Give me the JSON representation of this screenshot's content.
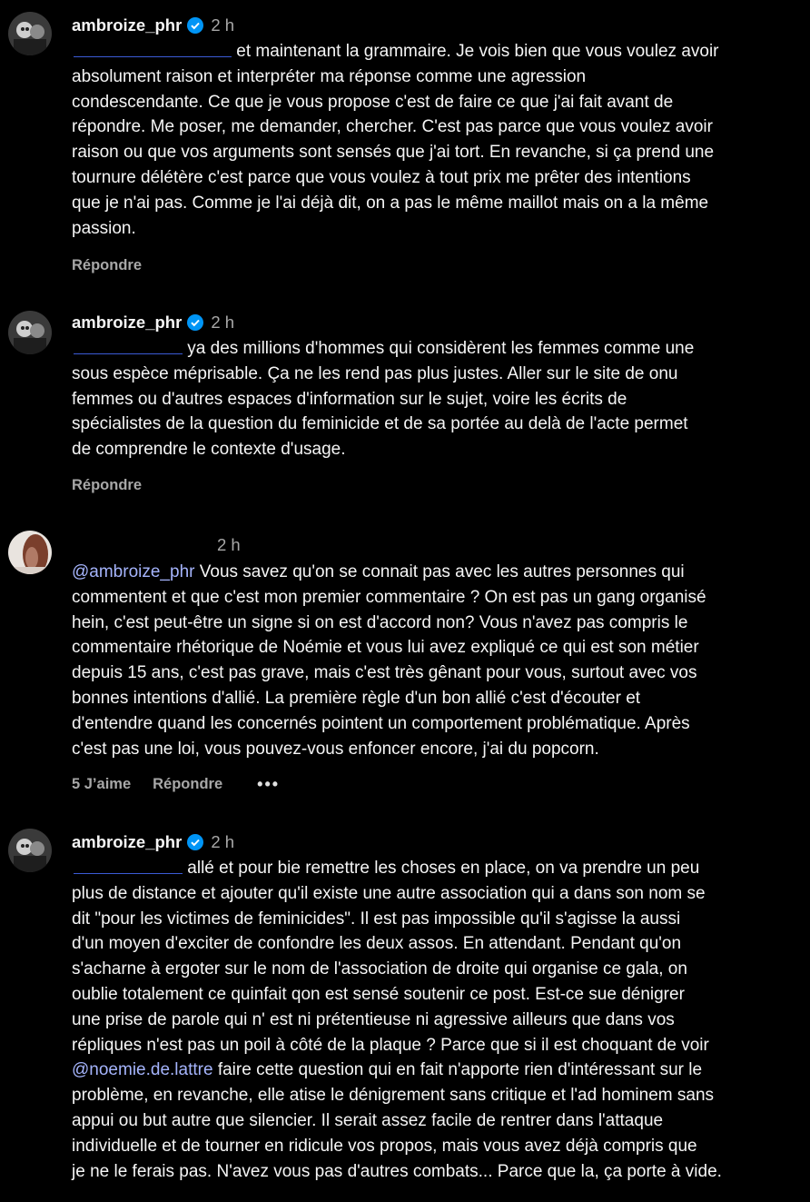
{
  "comments": [
    {
      "username": "ambroize_phr",
      "time": "2 h",
      "lines": [
        "et maintenant la grammaire. Je vois bien que vous voulez avoir",
        "absolument raison et interpréter ma réponse comme une agression",
        "condescendante. Ce que je vous propose c'est de faire ce que j'ai fait avant de",
        "répondre. Me poser, me demander, chercher. C'est pas parce que vous voulez avoir",
        "raison ou que vos arguments sont sensés que j'ai tort. En revanche, si ça prend une",
        "tournure délétère c'est parce que vous voulez à tout prix me prêter des intentions",
        "que je n'ai pas. Comme je l'ai déjà dit, on a pas le même maillot mais on a la même",
        "passion."
      ],
      "reply": "Répondre"
    },
    {
      "username": "ambroize_phr",
      "time": "2 h",
      "lines": [
        "ya des millions d'hommes qui considèrent les femmes comme une",
        "sous espèce méprisable. Ça ne les rend pas plus justes. Aller sur le site de onu",
        "femmes ou d'autres espaces d'information sur le sujet, voire les écrits de",
        "spécialistes de la question du feminicide et de sa portée au delà de l'acte permet",
        "de comprendre le contexte d'usage."
      ],
      "reply": "Répondre"
    },
    {
      "time": "2 h",
      "mention": "@ambroize_phr",
      "lines": [
        "Vous savez qu'on se connait pas avec les autres personnes qui",
        "commentent et que c'est mon premier commentaire ? On est pas un gang organisé",
        "hein, c'est peut-être un signe si on est d'accord non? Vous n'avez pas compris le",
        "commentaire rhétorique de Noémie et vous lui avez expliqué ce qui est son métier",
        "depuis 15 ans, c'est pas grave, mais c'est très gênant pour vous, surtout avec vos",
        "bonnes intentions d'allié. La première règle d'un bon allié c'est d'écouter et",
        "d'entendre quand les concernés pointent un comportement problématique. Après",
        "c'est pas une loi, vous pouvez-vous enfoncer encore, j'ai du popcorn."
      ],
      "likes": "5 J’aime",
      "reply": "Répondre",
      "more": "•••"
    },
    {
      "username": "ambroize_phr",
      "time": "2 h",
      "lines": [
        "allé et pour bie remettre les choses en place, on va prendre un peu",
        "plus de distance et ajouter qu'il existe une autre association qui a dans son nom se",
        "dit \"pour les victimes de feminicides\". Il est pas impossible qu'il s'agisse la aussi",
        "d'un moyen d'exciter de confondre les deux assos. En attendant. Pendant qu'on",
        "s'acharne à ergoter sur le nom de l'association de droite qui organise ce gala, on",
        "oublie totalement ce quinfait qon est sensé soutenir ce post. Est-ce sue dénigrer",
        "une prise de parole qui n' est ni prétentieuse ni agressive ailleurs que dans vos",
        "répliques n'est pas un poil à côté de la plaque ? Parce que si il est choquant de voir"
      ],
      "mention_line": {
        "mention": "@noemie.de.lattre",
        "text": "faire cette question qui en fait n'apporte rien d'intéressant sur le"
      },
      "lines_after": [
        "problème, en revanche, elle atise le dénigrement sans critique et l'ad hominem sans",
        "appui ou but autre que silencier. Il serait assez facile de rentrer dans l'attaque",
        "individuelle et de tourner en ridicule vos propos, mais vous avez déjà compris que",
        "je ne le ferais pas. N'avez vous pas d'autres combats... Parce que la, ça porte à vide."
      ]
    }
  ],
  "colors": {
    "background": "#000000",
    "text": "#f5f5f5",
    "muted": "#a8a8a8",
    "mention": "#a5b4fc",
    "verified": "#0095f6"
  }
}
